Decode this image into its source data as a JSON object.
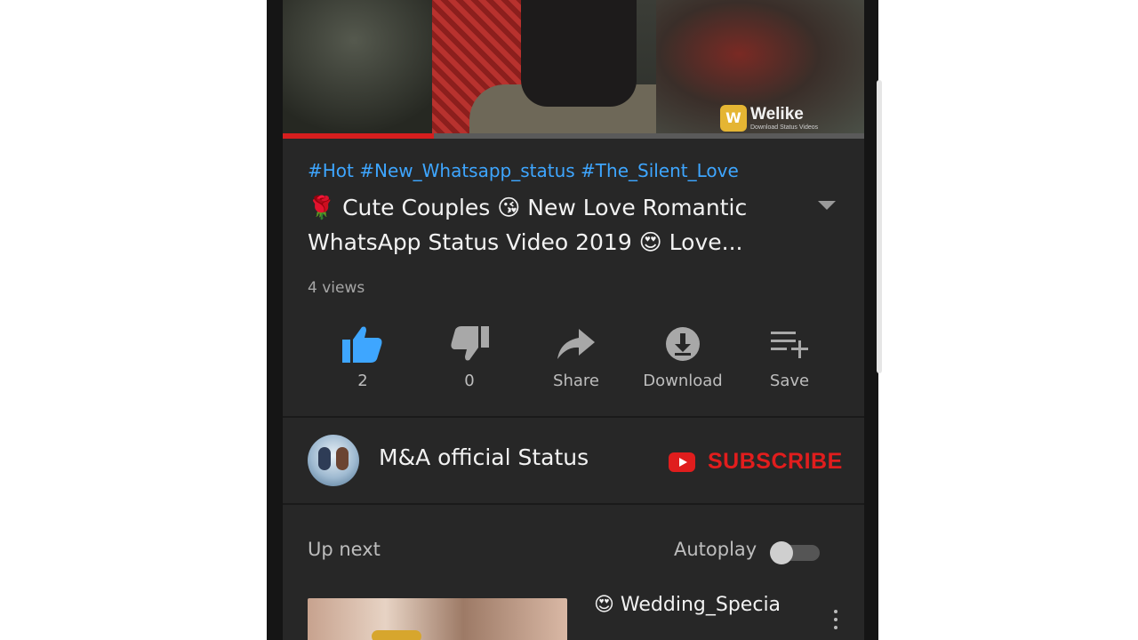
{
  "video": {
    "watermark_brand": "Welike",
    "watermark_tagline": "Download Status Videos",
    "progress": 0.26
  },
  "details": {
    "hashtags": "#Hot #New_Whatsapp_status #The_Silent_Love",
    "title": "🌹 Cute Couples 😘 New Love Romantic WhatsApp Status Video 2019 😍 Love...",
    "views": "4 views"
  },
  "actions": {
    "like_count": "2",
    "dislike_count": "0",
    "share_label": "Share",
    "download_label": "Download",
    "save_label": "Save"
  },
  "channel": {
    "name": "M&A official Status",
    "subscribe_label": "SUBSCRIBE"
  },
  "up_next": {
    "heading": "Up next",
    "autoplay_label": "Autoplay",
    "autoplay_on": false,
    "next_title": "😍 Wedding_Specia"
  },
  "colors": {
    "background": "#272727",
    "link_blue": "#3ea6ff",
    "like_blue": "#3ea6ff",
    "subscribe_red": "#e11d1d",
    "progress_red": "#d61e1e"
  },
  "icons": [
    "thumbs-up-icon",
    "thumbs-down-icon",
    "share-icon",
    "download-icon",
    "save-playlist-icon",
    "expand-icon",
    "youtube-icon",
    "more-vert-icon"
  ]
}
